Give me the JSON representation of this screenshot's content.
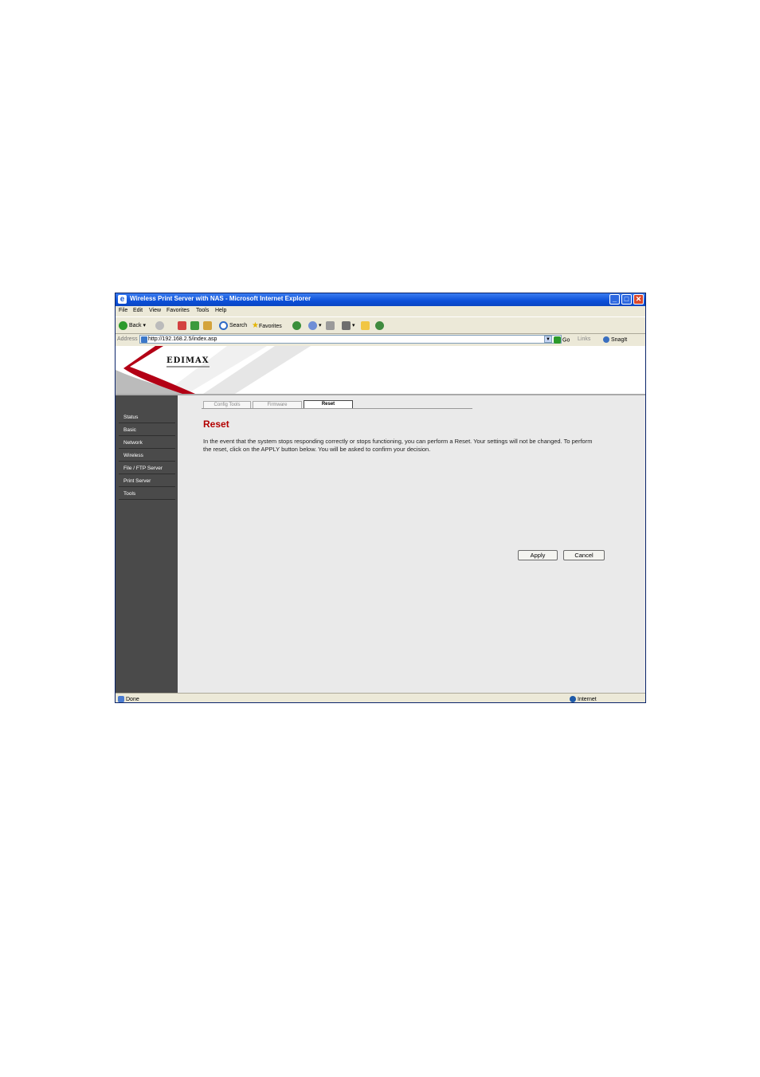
{
  "window": {
    "title": "Wireless Print Server with NAS - Microsoft Internet Explorer"
  },
  "menubar": [
    "File",
    "Edit",
    "View",
    "Favorites",
    "Tools",
    "Help"
  ],
  "toolbar": {
    "back": "Back",
    "search": "Search",
    "favorites": "Favorites"
  },
  "address": {
    "label": "Address",
    "url": "http://192.168.2.5/index.asp",
    "go": "Go",
    "links": "Links",
    "snagit": "SnagIt"
  },
  "brand": {
    "logo": "EDIMAX"
  },
  "sidebar": {
    "items": [
      "Status",
      "Basic",
      "Network",
      "Wireless",
      "File / FTP Server",
      "Print Server",
      "Tools"
    ]
  },
  "tabs": [
    "Config Tools",
    "Firmware",
    "Reset"
  ],
  "main": {
    "heading": "Reset",
    "description": "In the event that the system stops responding correctly or stops functioning, you can perform a Reset. Your settings will not be changed. To perform the reset, click on the APPLY button below. You will be asked to confirm your decision."
  },
  "buttons": {
    "apply": "Apply",
    "cancel": "Cancel"
  },
  "status": {
    "left": "Done",
    "zone": "Internet"
  },
  "colors": {
    "titlebar": "#0b4fd8",
    "sidebar": "#4a4a4a",
    "heading": "#b30000",
    "page_bg": "#eaeaea"
  }
}
